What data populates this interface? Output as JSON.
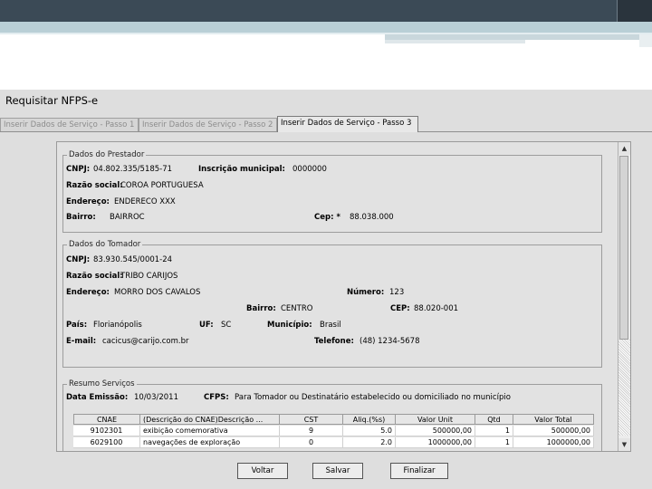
{
  "window": {
    "title": "Requisitar NFPS-e"
  },
  "tabs": [
    {
      "label": "Inserir Dados de Serviço - Passo 1",
      "active": false
    },
    {
      "label": "Inserir Dados de Serviço - Passo 2",
      "active": false
    },
    {
      "label": "Inserir Dados de Serviço - Passo 3",
      "active": true
    }
  ],
  "prestador": {
    "legend": "Dados do Prestador",
    "cnpj_label": "CNPJ:",
    "cnpj": "04.802.335/5185-71",
    "im_label": "Inscrição municipal:",
    "im": "0000000",
    "razao_label": "Razão social:",
    "razao": "COROA PORTUGUESA",
    "endereco_label": "Endereço:",
    "endereco": "ENDERECO XXX",
    "bairro_label": "Bairro:",
    "bairro": "BAIRROC",
    "cep_label": "Cep: *",
    "cep": "88.038.000"
  },
  "tomador": {
    "legend": "Dados do Tomador",
    "cnpj_label": "CNPJ:",
    "cnpj": "83.930.545/0001-24",
    "razao_label": "Razão social:",
    "razao": "TRIBO CARIJOS",
    "endereco_label": "Endereço:",
    "endereco": "MORRO DOS CAVALOS",
    "numero_label": "Número:",
    "numero": "123",
    "bairro_label": "Bairro:",
    "bairro": "CENTRO",
    "cep_label": "CEP:",
    "cep": "88.020-001",
    "pais_label": "País:",
    "pais": "Florianópolis",
    "uf_label": "UF:",
    "uf": "SC",
    "municipio_label": "Município:",
    "municipio": "Brasil",
    "email_label": "E-mail:",
    "email": "cacicus@carijo.com.br",
    "telefone_label": "Telefone:",
    "telefone": "(48) 1234-5678"
  },
  "resumo": {
    "legend": "Resumo Serviços",
    "data_label": "Data Emissão:",
    "data": "10/03/2011",
    "cfps_label": "CFPS:",
    "cfps": "Para Tomador ou Destinatário estabelecido ou domiciliado no município",
    "columns": [
      "CNAE",
      "(Descrição do CNAE)Descrição ...",
      "CST",
      "Aliq.(%s)",
      "Valor Unit",
      "Qtd",
      "Valor Total"
    ],
    "rows": [
      [
        "9102301",
        "exibição comemorativa",
        "9",
        "5.0",
        "500000,00",
        "1",
        "500000,00"
      ],
      [
        "6029100",
        "navegações de exploração",
        "0",
        "2.0",
        "1000000,00",
        "1",
        "1000000,00"
      ]
    ]
  },
  "buttons": {
    "voltar": "Voltar",
    "salvar": "Salvar",
    "finalizar": "Finalizar"
  },
  "colors": {
    "topbar": "#3b4a56",
    "accent": "#b9cfd6",
    "panel": "#dedede"
  }
}
